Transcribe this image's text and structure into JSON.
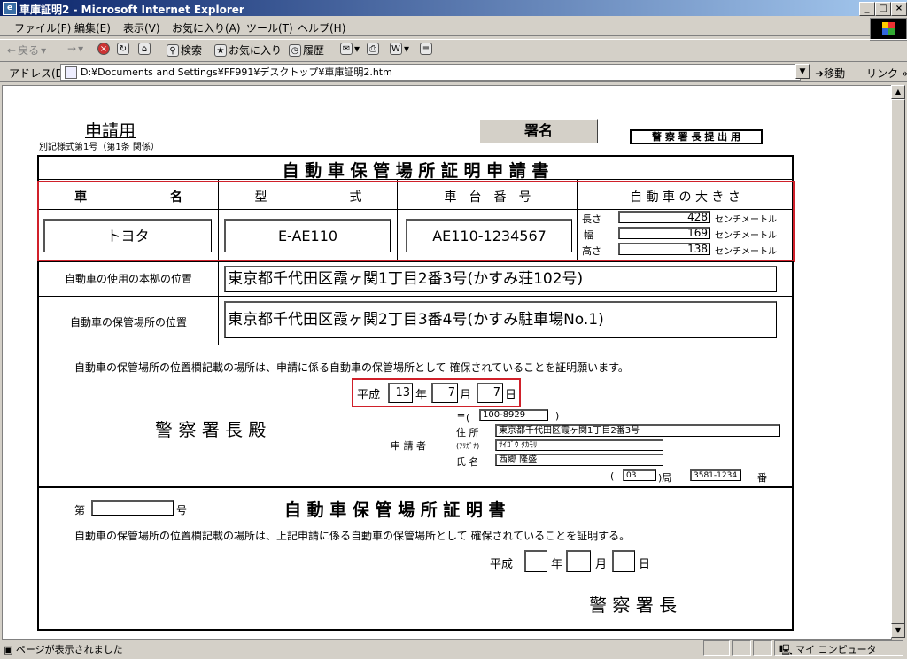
{
  "window": {
    "title": "車庫証明2 - Microsoft Internet Explorer",
    "minimize": "_",
    "maximize": "□",
    "close": "×"
  },
  "menu": [
    "ファイル(F)",
    "編集(E)",
    "表示(V)",
    "お気に入り(A)",
    "ツール(T)",
    "ヘルプ(H)"
  ],
  "toolbar": {
    "back": "戻る",
    "search": "検索",
    "favorites": "お気に入り",
    "history": "履歴"
  },
  "address": {
    "label": "アドレス(D)",
    "value": "D:¥Documents and Settings¥FF991¥デスクトップ¥車庫証明2.htm",
    "go": "移動",
    "links": "リンク »"
  },
  "status": {
    "text": "ページが表示されました",
    "zone": "マイ コンピュータ"
  },
  "form": {
    "apply_label": "申請用",
    "form_number": "別記様式第1号（第1条 関係）",
    "sign_button": "署名",
    "submit_note": "警 察 署 長 提 出 用",
    "main_title": "自 動 車 保 管 場 所 証 明 申 請 書",
    "col_headers": [
      "車 　　　　　　 名",
      "型 　　　　　　 式",
      "車　台　番　号",
      "自 動 車 の 大 き さ"
    ],
    "car_name": "トヨタ",
    "model": "E-AE110",
    "chassis": "AE110-1234567",
    "size": [
      {
        "label": "長さ",
        "value": "428",
        "unit": "センチメートル"
      },
      {
        "label": "幅",
        "value": "169",
        "unit": "センチメートル"
      },
      {
        "label": "高さ",
        "value": "138",
        "unit": "センチメートル"
      }
    ],
    "base_label": "自動車の使用の本拠の位置",
    "base_value": "東京都千代田区霞ヶ関1丁目2番3号(かすみ荘102号)",
    "storage_label": "自動車の保管場所の位置",
    "storage_value": "東京都千代田区霞ヶ関2丁目3番4号(かすみ駐車場No.1)",
    "request_text": "自動車の保管場所の位置欄記載の場所は、申請に係る自動車の保管場所として 確保されていることを証明願います。",
    "date": {
      "era": "平成",
      "year": "13",
      "year_unit": "年",
      "month": "7",
      "month_unit": "月",
      "day": "7",
      "day_unit": "日"
    },
    "chief_to": "警 察 署 長 殿",
    "applicant_label": "申 請 者",
    "postal_label": "〒(",
    "postal_close": ")",
    "postal": "100-8929",
    "address_label": "住 所",
    "address_value": "東京都千代田区霞ヶ関1丁目2番3号",
    "kana_label": "(ﾌﾘｶﾞﾅ)",
    "kana_value": "ｻｲｺﾞｳ ﾀｶﾓﾘ",
    "name_label": "氏 名",
    "name_value": "西郷 隆盛",
    "phone_open": "(",
    "phone_area": "03",
    "phone_mid": ")局",
    "phone_local": "3581-1234",
    "phone_end": "番",
    "cert_no_prefix": "第",
    "cert_no_suffix": "号",
    "cert_title": "自 動 車 保 管 場 所 証 明 書",
    "cert_text": "自動車の保管場所の位置欄記載の場所は、上記申請に係る自動車の保管場所として 確保されていることを証明する。",
    "cert_date": {
      "era": "平成",
      "year_unit": "年",
      "month_unit": "月",
      "day_unit": "日"
    },
    "cert_chief": "警 察 署 長"
  }
}
